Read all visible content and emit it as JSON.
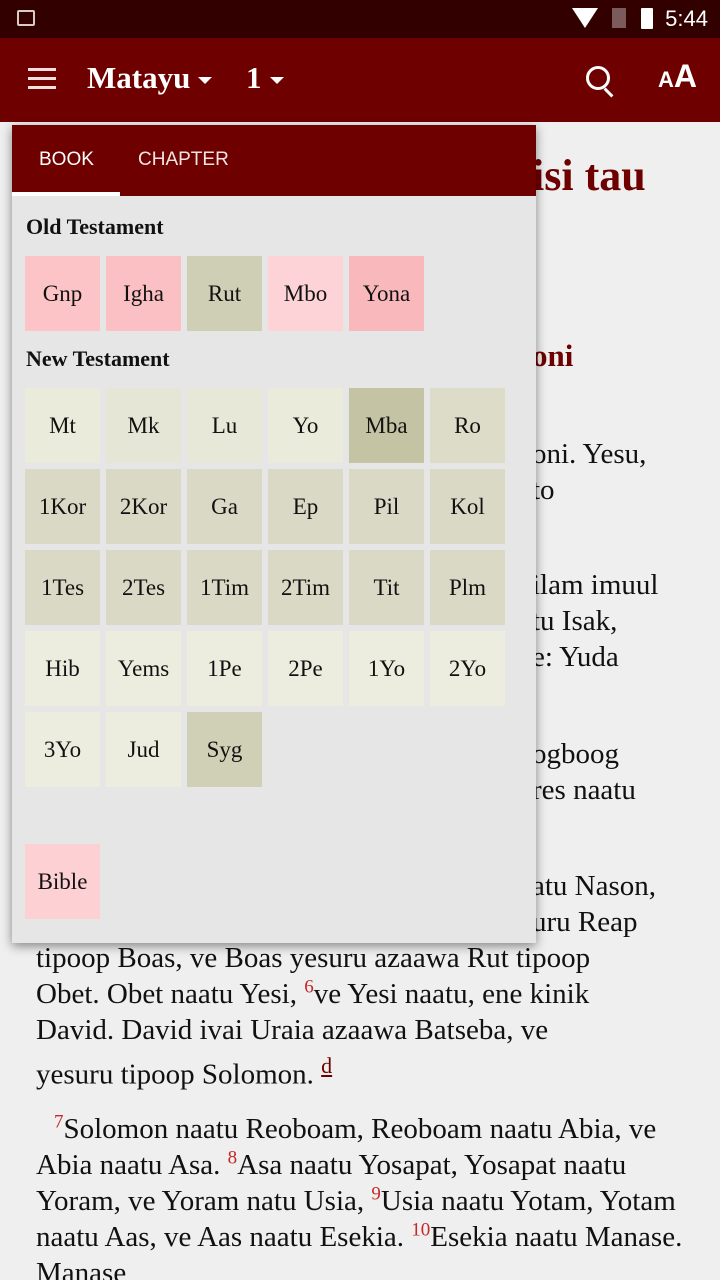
{
  "status_bar": {
    "time": "5:44",
    "icons": [
      "gallery-icon",
      "wifi-icon",
      "no-sim-icon",
      "battery-icon"
    ]
  },
  "app_bar": {
    "book": "Matayu",
    "chapter": "1",
    "icons": [
      "menu-icon",
      "search-icon",
      "text-size-icon"
    ],
    "text_size_label_small": "A",
    "text_size_label_large": "A"
  },
  "colors": {
    "accent": "#6e0000",
    "status_bar": "#330000",
    "verse_number": "#c62828"
  },
  "background_text": {
    "title_fragment": "isi tau",
    "heading_fragment": "oni",
    "fragments": [
      "oni. Yesu,",
      "to",
      "ilam imuul",
      "tu Isak,",
      "e: Yuda",
      "ogboog",
      "res naatu",
      "atu Nason,",
      "uru Reap"
    ],
    "p1": {
      "l1": "tipoop Boas, ve Boas yesuru azaawa Rut tipoop",
      "l2a": "Obet. Obet naatu Yesi, ",
      "v6": "6",
      "l2b": "ve Yesi naatu, ene kinik",
      "l3": "David. David ivai Uraia azaawa Batseba, ve",
      "l4": "yesuru tipoop Solomon. ",
      "fn": "d"
    },
    "p2": {
      "v7": "7",
      "a": "Solomon naatu Reoboam, Reoboam naatu Abia, ve Abia naatu Asa. ",
      "v8": "8",
      "b": "Asa naatu Yosapat, Yosapat naatu Yoram, ve Yoram natu Usia, ",
      "v9": "9",
      "c": "Usia naatu Yotam, Yotam naatu Aas, ve Aas naatu Esekia. ",
      "v10": "10",
      "d": "Esekia naatu Manase. Manase"
    }
  },
  "picker": {
    "tabs": [
      {
        "label": "BOOK",
        "selected": true
      },
      {
        "label": "CHAPTER",
        "selected": false
      }
    ],
    "old_testament": {
      "heading": "Old Testament",
      "books": [
        {
          "label": "Gnp",
          "color": "#fcc4c7"
        },
        {
          "label": "Igha",
          "color": "#fbc0c3"
        },
        {
          "label": "Rut",
          "color": "#cfcfb6"
        },
        {
          "label": "Mbo",
          "color": "#fdd3d7"
        },
        {
          "label": "Yona",
          "color": "#f9b8bc"
        }
      ]
    },
    "new_testament": {
      "heading": "New Testament",
      "books": [
        {
          "label": "Mt",
          "color": "#ebebdc"
        },
        {
          "label": "Mk",
          "color": "#e6e6d6"
        },
        {
          "label": "Lu",
          "color": "#e8e8d9"
        },
        {
          "label": "Yo",
          "color": "#ebebdc"
        },
        {
          "label": "Mba",
          "color": "#c4c4a4"
        },
        {
          "label": "Ro",
          "color": "#dcdcc8"
        },
        {
          "label": "1Kor",
          "color": "#d9d9c6"
        },
        {
          "label": "2Kor",
          "color": "#d9d9c6"
        },
        {
          "label": "Ga",
          "color": "#d9d9c6"
        },
        {
          "label": "Ep",
          "color": "#d9d9c6"
        },
        {
          "label": "Pil",
          "color": "#d9d9c6"
        },
        {
          "label": "Kol",
          "color": "#d9d9c6"
        },
        {
          "label": "1Tes",
          "color": "#d9d9c6"
        },
        {
          "label": "2Tes",
          "color": "#d9d9c6"
        },
        {
          "label": "1Tim",
          "color": "#d9d9c6"
        },
        {
          "label": "2Tim",
          "color": "#d9d9c6"
        },
        {
          "label": "Tit",
          "color": "#d9d9c6"
        },
        {
          "label": "Plm",
          "color": "#d9d9c6"
        },
        {
          "label": "Hib",
          "color": "#ececdf"
        },
        {
          "label": "Yems",
          "color": "#ececdf"
        },
        {
          "label": "1Pe",
          "color": "#ececdf"
        },
        {
          "label": "2Pe",
          "color": "#ececdf"
        },
        {
          "label": "1Yo",
          "color": "#ececdf"
        },
        {
          "label": "2Yo",
          "color": "#ececdf"
        },
        {
          "label": "3Yo",
          "color": "#ececdf"
        },
        {
          "label": "Jud",
          "color": "#ececdf"
        },
        {
          "label": "Syg",
          "color": "#d0d0b6"
        }
      ]
    },
    "other": {
      "books": [
        {
          "label": "Bible",
          "color": "#fdd0d4"
        }
      ]
    }
  }
}
